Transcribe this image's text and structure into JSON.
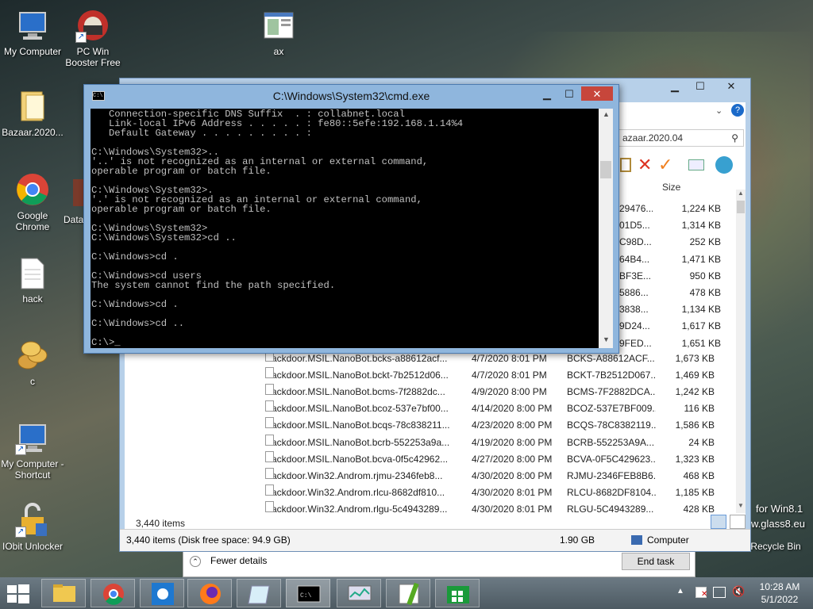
{
  "desktop": {
    "icons": [
      {
        "label": "My Computer"
      },
      {
        "label": "PC Win Booster Free"
      },
      {
        "label": "ax"
      },
      {
        "label": "Bazaar.2020..."
      },
      {
        "label": "Google Chrome"
      },
      {
        "label": "Data"
      },
      {
        "label": "hack"
      },
      {
        "label": "c"
      },
      {
        "label": "My Computer - Shortcut"
      },
      {
        "label": "IObit Unlocker"
      },
      {
        "label": "Recycle Bin"
      }
    ],
    "watermark_line1": "for Win8.1",
    "watermark_line2": "w.glass8.eu"
  },
  "cmd": {
    "title": "C:\\Windows\\System32\\cmd.exe",
    "lines": [
      "   Connection-specific DNS Suffix  . : collabnet.local",
      "   Link-local IPv6 Address . . . . . : fe80::5efe:192.168.1.14%4",
      "   Default Gateway . . . . . . . . . :",
      "",
      "C:\\Windows\\System32>..",
      "'..' is not recognized as an internal or external command,",
      "operable program or batch file.",
      "",
      "C:\\Windows\\System32>.",
      "'.' is not recognized as an internal or external command,",
      "operable program or batch file.",
      "",
      "C:\\Windows\\System32>",
      "C:\\Windows\\System32>cd ..",
      "",
      "C:\\Windows>cd .",
      "",
      "C:\\Windows>cd users",
      "The system cannot find the path specified.",
      "",
      "C:\\Windows>cd .",
      "",
      "C:\\Windows>cd ..",
      "",
      "C:\\>"
    ]
  },
  "explorer": {
    "address": "azaar.2020.04",
    "column_size": "Size",
    "partial_rows": [
      {
        "type": "29476...",
        "size": "1,224 KB"
      },
      {
        "type": "01D5...",
        "size": "1,314 KB"
      },
      {
        "type": "C98D...",
        "size": "252 KB"
      },
      {
        "type": "64B4...",
        "size": "1,471 KB"
      },
      {
        "type": "BF3E...",
        "size": "950 KB"
      },
      {
        "type": "5886...",
        "size": "478 KB"
      },
      {
        "type": "3838...",
        "size": "1,134 KB"
      },
      {
        "type": "9D24...",
        "size": "1,617 KB"
      },
      {
        "type": "9FED...",
        "size": "1,651 KB"
      }
    ],
    "rows": [
      {
        "name": "Backdoor.MSIL.NanoBot.bcks-a88612acf...",
        "date": "4/7/2020 8:01 PM",
        "type": "BCKS-A88612ACF...",
        "size": "1,673 KB"
      },
      {
        "name": "Backdoor.MSIL.NanoBot.bckt-7b2512d06...",
        "date": "4/7/2020 8:01 PM",
        "type": "BCKT-7B2512D067...",
        "size": "1,469 KB"
      },
      {
        "name": "Backdoor.MSIL.NanoBot.bcms-7f2882dc...",
        "date": "4/9/2020 8:00 PM",
        "type": "BCMS-7F2882DCA...",
        "size": "1,242 KB"
      },
      {
        "name": "Backdoor.MSIL.NanoBot.bcoz-537e7bf00...",
        "date": "4/14/2020 8:00 PM",
        "type": "BCOZ-537E7BF009...",
        "size": "116 KB"
      },
      {
        "name": "Backdoor.MSIL.NanoBot.bcqs-78c838211...",
        "date": "4/23/2020 8:00 PM",
        "type": "BCQS-78C8382119...",
        "size": "1,586 KB"
      },
      {
        "name": "Backdoor.MSIL.NanoBot.bcrb-552253a9a...",
        "date": "4/19/2020 8:00 PM",
        "type": "BCRB-552253A9A...",
        "size": "24 KB"
      },
      {
        "name": "Backdoor.MSIL.NanoBot.bcva-0f5c42962...",
        "date": "4/27/2020 8:00 PM",
        "type": "BCVA-0F5C429623...",
        "size": "1,323 KB"
      },
      {
        "name": "Backdoor.Win32.Androm.rjmu-2346feb8...",
        "date": "4/30/2020 8:00 PM",
        "type": "RJMU-2346FEB8B6...",
        "size": "468 KB"
      },
      {
        "name": "Backdoor.Win32.Androm.rlcu-8682df810...",
        "date": "4/30/2020 8:01 PM",
        "type": "RLCU-8682DF8104...",
        "size": "1,185 KB"
      },
      {
        "name": "Backdoor.Win32.Androm.rlgu-5c4943289...",
        "date": "4/30/2020 8:01 PM",
        "type": "RLGU-5C4943289...",
        "size": "428 KB"
      }
    ],
    "item_count": "3,440 items",
    "status_left": "3,440 items (Disk free space: 94.9 GB)",
    "status_size": "1.90 GB",
    "status_location": "Computer"
  },
  "task_manager": {
    "fewer_details": "Fewer details",
    "end_task": "End task"
  },
  "taskbar": {
    "time": "10:28 AM",
    "date": "5/1/2022"
  }
}
